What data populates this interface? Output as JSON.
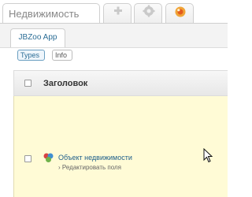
{
  "tabs": {
    "main_label": "Недвижимость"
  },
  "app_tab": {
    "label": "JBZoo App"
  },
  "filters": {
    "types_label": "Types",
    "info_label": "Info"
  },
  "table": {
    "header": "Заголовок",
    "rows": [
      {
        "title": "Объект недвижимости",
        "subtitle": "› Редактировать поля"
      }
    ]
  },
  "colors": {
    "row_highlight": "#fffbd6",
    "link": "#1f5f8b"
  },
  "icons": [
    "plus-icon",
    "gear-icon",
    "app-logo-icon",
    "type-icon",
    "mouse-cursor-icon"
  ]
}
